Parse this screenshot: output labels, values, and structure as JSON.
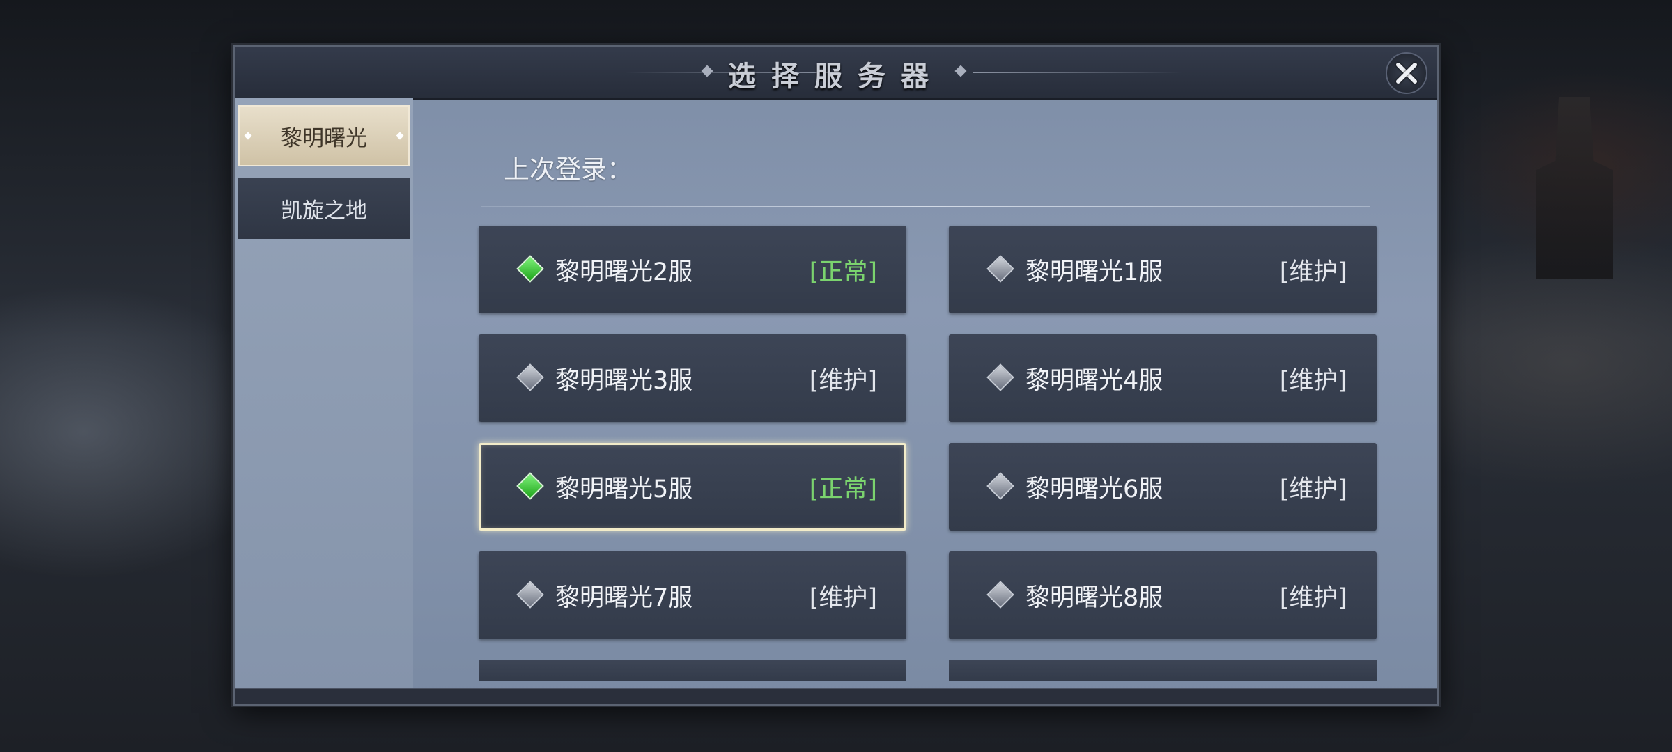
{
  "dialog": {
    "title": "选择服务器",
    "close_icon": "close-icon"
  },
  "sidebar": {
    "tabs": [
      {
        "label": "黎明曙光",
        "active": true
      },
      {
        "label": "凯旋之地",
        "active": false
      }
    ]
  },
  "main": {
    "last_login_label": "上次登录：",
    "servers": [
      {
        "name": "黎明曙光2服",
        "status": "[正常]",
        "state": "online"
      },
      {
        "name": "黎明曙光1服",
        "status": "[维护]",
        "state": "maintenance"
      },
      {
        "name": "黎明曙光3服",
        "status": "[维护]",
        "state": "maintenance"
      },
      {
        "name": "黎明曙光4服",
        "status": "[维护]",
        "state": "maintenance"
      },
      {
        "name": "黎明曙光5服",
        "status": "[正常]",
        "state": "online",
        "selected": true
      },
      {
        "name": "黎明曙光6服",
        "status": "[维护]",
        "state": "maintenance"
      },
      {
        "name": "黎明曙光7服",
        "status": "[维护]",
        "state": "maintenance"
      },
      {
        "name": "黎明曙光8服",
        "status": "[维护]",
        "state": "maintenance"
      }
    ]
  },
  "colors": {
    "status_online": "#7bd36e",
    "status_maintenance": "#e3e6ec",
    "selected_border": "#f3ecc9"
  }
}
